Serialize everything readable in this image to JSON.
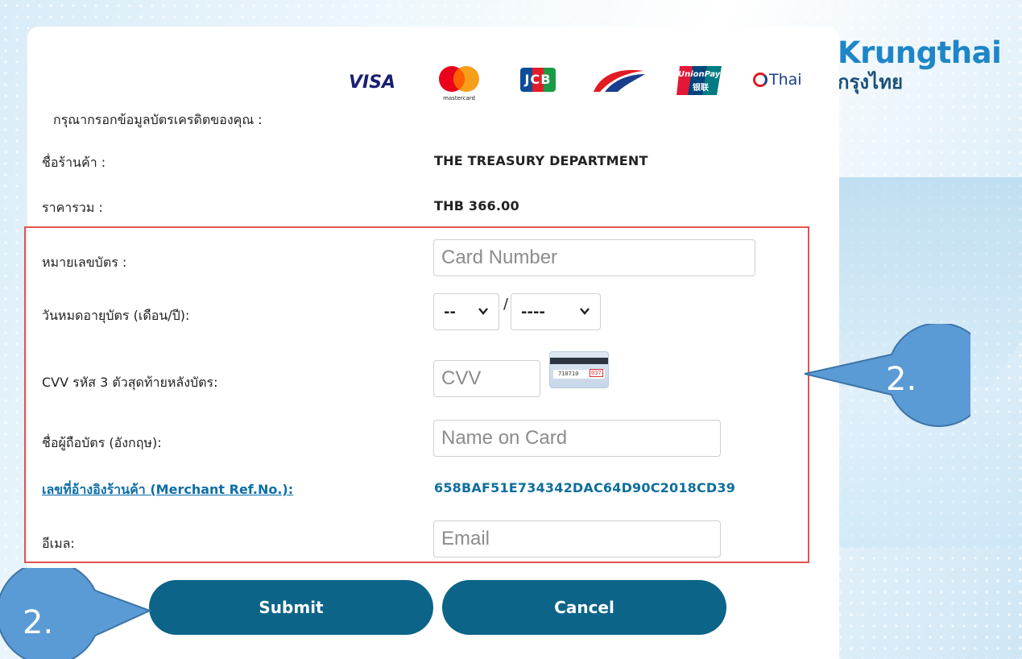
{
  "brand": {
    "name_en": "Krungthai",
    "name_th": "กรุงไทย"
  },
  "logos": {
    "visa": "VISA",
    "mastercard": "mastercard",
    "jcb": "JCB",
    "unionpay_en": "UnionPay",
    "unionpay_cn": "银联",
    "thai": "Thai"
  },
  "form": {
    "intro": "กรุณากรอกข้อมูลบัตรเครดิตของคุณ :",
    "merchant_label": "ชื่อร้านค้า :",
    "merchant_value": "THE TREASURY DEPARTMENT",
    "total_label": "ราคารวม :",
    "total_value": "THB 366.00",
    "card_number_label": "หมายเลขบัตร :",
    "card_number_placeholder": "Card Number",
    "expiry_label": "วันหมดอายุบัตร (เดือน/ปี):",
    "expiry_month": "--",
    "expiry_separator": "/",
    "expiry_year": "----",
    "cvv_label": "CVV รหัส 3 ตัวสุดท้ายหลังบัตร:",
    "cvv_placeholder": "CVV",
    "cvv_card_digits": "710710",
    "cvv_card_code": "037",
    "name_label": "ชื่อผู้ถือบัตร (อังกฤษ):",
    "name_placeholder": "Name on Card",
    "ref_label": "เลขที่อ้างอิงร้านค้า (Merchant Ref.No.):",
    "ref_value": "658BAF51E734342DAC64D90C2018CD39",
    "email_label": "อีเมล:",
    "email_placeholder": "Email"
  },
  "buttons": {
    "submit": "Submit",
    "cancel": "Cancel"
  },
  "callouts": {
    "right": "2.",
    "left": "2."
  },
  "colors": {
    "button": "#0c6488",
    "highlight_border": "#e35252",
    "callout": "#5b9bd5",
    "brand_blue": "#1e86c8",
    "link": "#0e6fa8"
  }
}
